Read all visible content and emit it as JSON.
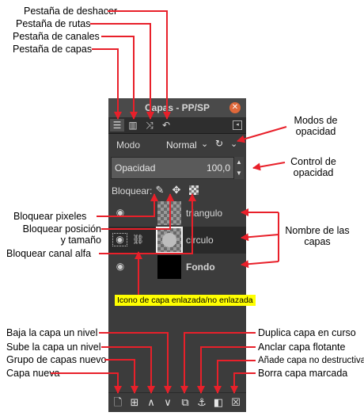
{
  "window": {
    "title": "Capas - PP/SP",
    "close_icon": "close-icon"
  },
  "tabs": [
    {
      "name": "layers-tab",
      "icon": "layers-icon",
      "glyph": "☰"
    },
    {
      "name": "channels-tab",
      "icon": "channels-icon",
      "glyph": "▥"
    },
    {
      "name": "paths-tab",
      "icon": "paths-icon",
      "glyph": "⤨"
    },
    {
      "name": "undo-tab",
      "icon": "undo-icon",
      "glyph": "↶"
    }
  ],
  "mode": {
    "label": "Modo",
    "value": "Normal"
  },
  "opacity": {
    "label": "Opacidad",
    "value": "100,0"
  },
  "lock": {
    "label": "Bloquear:"
  },
  "layers": [
    {
      "name": "triangulo",
      "thumb": "checker",
      "selected": false,
      "bold": false
    },
    {
      "name": "circulo",
      "thumb": "checker",
      "selected": true,
      "bold": false
    },
    {
      "name": "Fondo",
      "thumb": "black",
      "selected": false,
      "bold": true
    }
  ],
  "chain_note": "Icono de capa enlazada/no enlazada",
  "annotations": {
    "undo_tab": "Pestaña de deshacer",
    "paths_tab": "Pestaña de rutas",
    "channels_tab": "Pestaña de canales",
    "layers_tab": "Pestaña de capas",
    "blend_modes": "Modos de\nopacidad",
    "opacity_control": "Control de\nopacidad",
    "lock_pixels": "Bloquear pixeles",
    "lock_position": "Bloquear  posición\ny tamaño",
    "lock_alpha": "Bloquear canal alfa",
    "layer_names": "Nombre de las\ncapas",
    "lower_layer": "Baja la capa un nivel",
    "raise_layer": "Sube la capa un nivel",
    "new_group": "Grupo de capas nuevo",
    "new_layer": "Capa nueva",
    "duplicate_layer": "Duplica capa en curso",
    "anchor_layer": "Anclar capa flotante",
    "add_mask": "Añade capa no destructiva",
    "delete_layer": "Borra capa marcada"
  },
  "colors": {
    "arrow": "#e8202a",
    "panel_bg": "#3c3c3c",
    "note_bg": "#ffff00"
  }
}
